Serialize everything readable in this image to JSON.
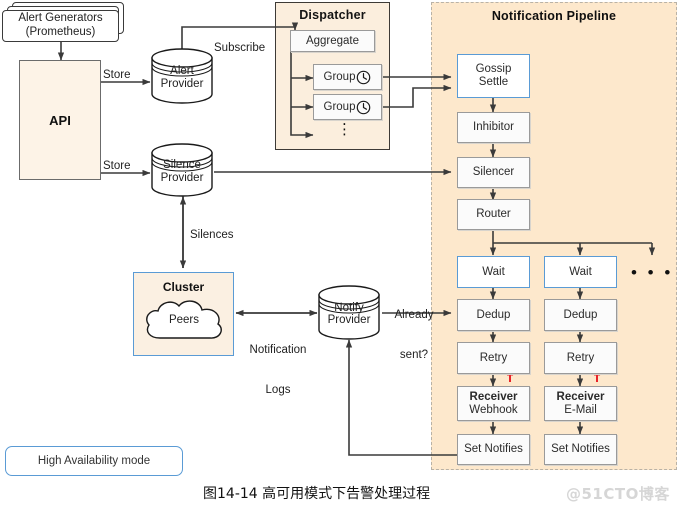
{
  "diagram": {
    "caption": "图14-14 高可用模式下告警处理过程",
    "watermark": "@51CTO博客",
    "colors": {
      "pipeline_fill": "#fde8cc",
      "dispatcher_fill": "#fbeedd",
      "api_fill": "#fdf3e7",
      "accent_blue": "#5a9bd5",
      "retry_arrow_red": "#e8232a",
      "line": "#3a3a3a"
    }
  },
  "alert_generators": {
    "line1": "Alert Generators",
    "line2": "(Prometheus)",
    "stack_count": 3
  },
  "api": {
    "label": "API"
  },
  "datastores": {
    "alert_provider": {
      "line1": "Alert",
      "line2": "Provider"
    },
    "silence_provider": {
      "line1": "Silence",
      "line2": "Provider"
    },
    "notify_provider": {
      "line1": "Notify",
      "line2": "Provider"
    }
  },
  "dispatcher": {
    "title": "Dispatcher",
    "aggregate": "Aggregate",
    "groups": [
      {
        "label": "Group",
        "icon": "clock-icon"
      },
      {
        "label": "Group",
        "icon": "clock-icon"
      }
    ],
    "more_indicator": "⋮"
  },
  "pipeline": {
    "title": "Notification Pipeline",
    "stages": [
      {
        "label": "Gossip\nSettle",
        "line1": "Gossip",
        "line2": "Settle",
        "highlight": true
      },
      {
        "label": "Inhibitor",
        "line1": "Inhibitor",
        "highlight": false
      },
      {
        "label": "Silencer",
        "line1": "Silencer",
        "highlight": false
      },
      {
        "label": "Router",
        "line1": "Router",
        "highlight": false
      }
    ],
    "branches": [
      {
        "wait": "Wait",
        "dedup": "Dedup",
        "retry": "Retry",
        "receiver_title": "Receiver",
        "receiver_kind": "Webhook",
        "set_notifies": "Set Notifies"
      },
      {
        "wait": "Wait",
        "dedup": "Dedup",
        "retry": "Retry",
        "receiver_title": "Receiver",
        "receiver_kind": "E-Mail",
        "set_notifies": "Set Notifies"
      }
    ],
    "more_branches_indicator": "• • •"
  },
  "cluster": {
    "title": "Cluster",
    "peers": "Peers"
  },
  "edge_labels": {
    "store_alert": "Store",
    "store_silence": "Store",
    "subscribe": "Subscribe",
    "silences": "Silences",
    "notification_logs_l1": "Notification",
    "notification_logs_l2": "Logs",
    "already_sent_l1": "Already",
    "already_sent_l2": "sent?"
  },
  "legend": {
    "label": "High Availability mode"
  }
}
